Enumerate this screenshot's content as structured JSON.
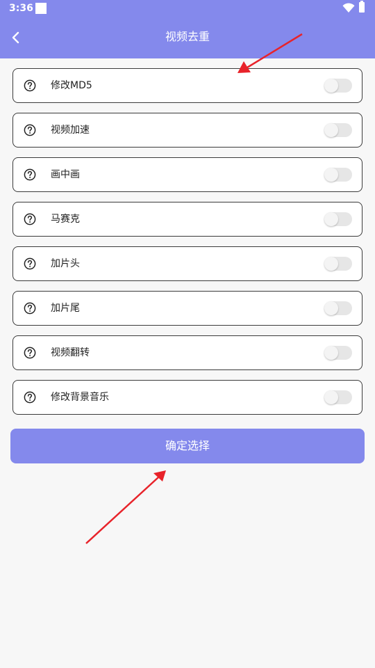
{
  "status_bar": {
    "time": "3:36"
  },
  "header": {
    "title": "视频去重",
    "back_icon": "chevron-left-icon"
  },
  "options": [
    {
      "label": "修改MD5",
      "enabled": false
    },
    {
      "label": "视频加速",
      "enabled": false
    },
    {
      "label": "画中画",
      "enabled": false
    },
    {
      "label": "马赛克",
      "enabled": false
    },
    {
      "label": "加片头",
      "enabled": false
    },
    {
      "label": "加片尾",
      "enabled": false
    },
    {
      "label": "视频翻转",
      "enabled": false
    },
    {
      "label": "修改背景音乐",
      "enabled": false
    }
  ],
  "confirm_button": {
    "label": "确定选择"
  },
  "colors": {
    "accent": "#8489ec",
    "annotation_arrow": "#e8232a",
    "toggle_off_track": "#e6e6e6"
  }
}
